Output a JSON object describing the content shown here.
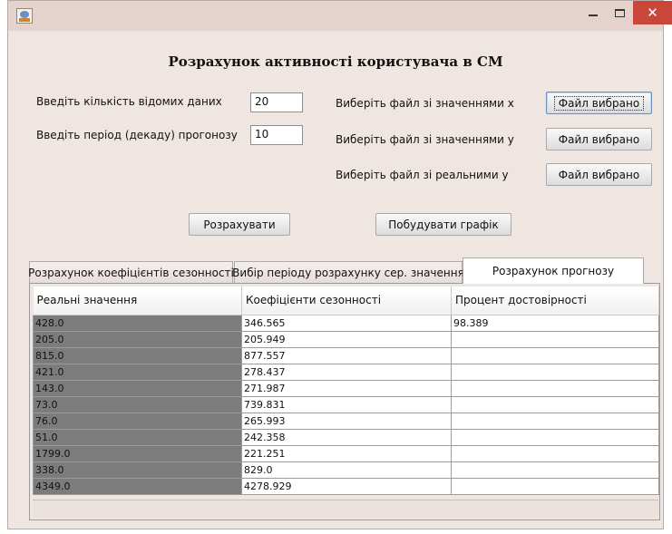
{
  "window": {
    "title": "",
    "controls": {
      "minimize": "minimize",
      "maximize": "maximize",
      "close": "✕"
    }
  },
  "heading": "Розрахунок активності користувача в СМ",
  "form": {
    "known_count_label": "Введіть кількість відомих даних",
    "known_count_value": "20",
    "period_label": "Введіть період (декаду) прогонозу",
    "period_value": "10",
    "file_x_label": "Виберіть файл зі значеннями х",
    "file_y_label": "Виберіть файл зі значеннями у",
    "file_real_label": "Виберіть файл зі реальними у",
    "file_x_button": "Файл вибрано",
    "file_y_button": "Файл вибрано",
    "file_real_button": "Файл вибрано"
  },
  "actions": {
    "calculate": "Розрахувати",
    "build_chart": "Побудувати графік"
  },
  "tabs": [
    {
      "label": "Розрахунок коефіцієнтів сезонності",
      "active": false
    },
    {
      "label": "Вибір періоду розрахунку сер. значення",
      "active": false
    },
    {
      "label": "Розрахунок прогнозу",
      "active": true
    }
  ],
  "table": {
    "columns": [
      "Реальні значення",
      "Коефіцієнти сезонності",
      "Процент достовірності"
    ],
    "rows": [
      [
        "428.0",
        "346.565",
        "98.389"
      ],
      [
        "205.0",
        "205.949",
        ""
      ],
      [
        "815.0",
        "877.557",
        ""
      ],
      [
        "421.0",
        "278.437",
        ""
      ],
      [
        "143.0",
        "271.987",
        ""
      ],
      [
        "73.0",
        "739.831",
        ""
      ],
      [
        "76.0",
        "265.993",
        ""
      ],
      [
        "51.0",
        "242.358",
        ""
      ],
      [
        "1799.0",
        "221.251",
        ""
      ],
      [
        "338.0",
        "829.0",
        ""
      ],
      [
        "4349.0",
        "4278.929",
        ""
      ]
    ]
  },
  "colors": {
    "window_bg": "#efe5e1",
    "titlebar": "#e5d2cc",
    "close_button": "#c9463a",
    "selected_column": "#7c7c7c"
  }
}
